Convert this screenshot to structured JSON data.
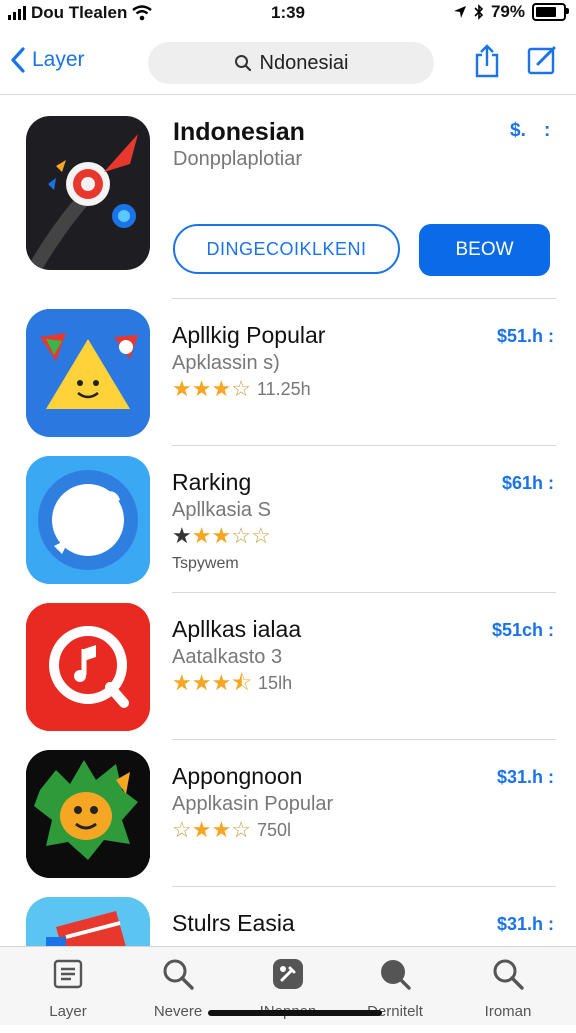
{
  "status": {
    "carrier": "Dou Tlealen",
    "time": "1:39",
    "battery": "79%"
  },
  "nav": {
    "back_label": "Layer",
    "search_text": "Ndonesiai"
  },
  "featured": {
    "title": "Indonesian",
    "subtitle": "Donpplaplotiar",
    "price": "$.",
    "more": ":",
    "button_outline": "DINGECOIKLKENI",
    "button_fill": "BEOW"
  },
  "apps": [
    {
      "title": "Apllkig Popular",
      "subtitle": "Apklassin s)",
      "rating": 3,
      "count": "11.25h",
      "extra": "",
      "price": "$51.h :"
    },
    {
      "title": "Rarking",
      "subtitle": "Apllkasia S",
      "rating": 3,
      "count": "",
      "extra": "Tspywem",
      "price": "$61h :"
    },
    {
      "title": "Apllkas ialaa",
      "subtitle": "Aatalkasto 3",
      "rating": 3.5,
      "count": "15lh",
      "extra": "",
      "price": "$51ch :"
    },
    {
      "title": "Appongnoon",
      "subtitle": "Applkasin Popular",
      "rating": 3,
      "count": "750l",
      "extra": "",
      "price": "$31.h :"
    },
    {
      "title": "Stulrs Easia",
      "subtitle": "",
      "rating": 0,
      "count": "",
      "extra": "",
      "price": "$31.h :"
    }
  ],
  "tabs": [
    {
      "label": "Layer",
      "icon": "list-icon"
    },
    {
      "label": "Nevere",
      "icon": "search-icon"
    },
    {
      "label": "INopnon",
      "icon": "tools-icon"
    },
    {
      "label": "Dernitelt",
      "icon": "search-icon"
    },
    {
      "label": "Iroman",
      "icon": "search-icon"
    }
  ],
  "colors": {
    "accent": "#1a73e8",
    "star": "#f5a623"
  }
}
